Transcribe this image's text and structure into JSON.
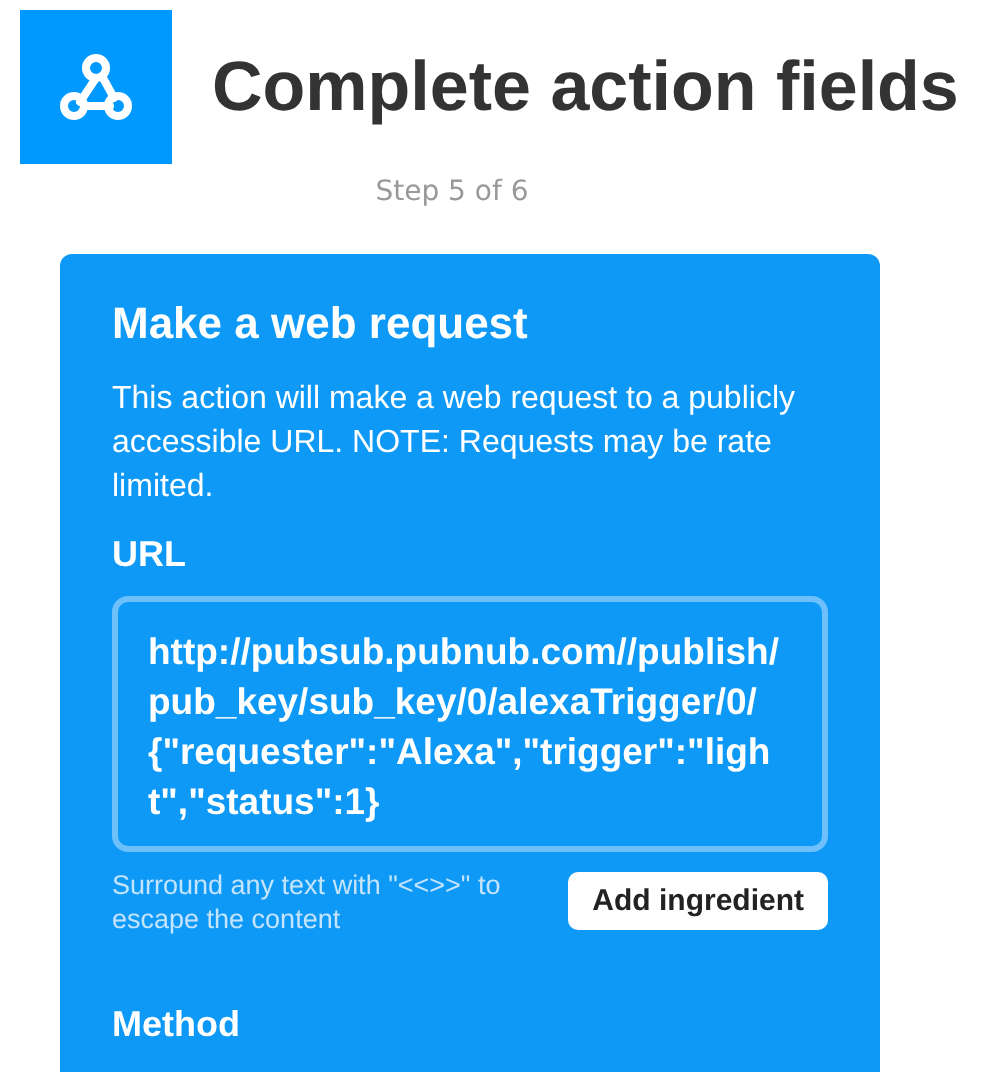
{
  "header": {
    "title": "Complete action fields",
    "step": "Step 5 of 6"
  },
  "action": {
    "title": "Make a web request",
    "description": "This action will make a web request to a publicly accessible URL. NOTE: Requests may be rate limited.",
    "fields": [
      {
        "label": "URL",
        "value": "http://pubsub.pubnub.com//publish/pub_key/sub_key/0/alexaTrigger/0/{\"requester\":\"Alexa\",\"trigger\":\"light\",\"status\":1}",
        "hint": "Surround any text with \"<<>>\" to escape the content",
        "button": "Add ingredient"
      },
      {
        "label": "Method"
      }
    ]
  }
}
